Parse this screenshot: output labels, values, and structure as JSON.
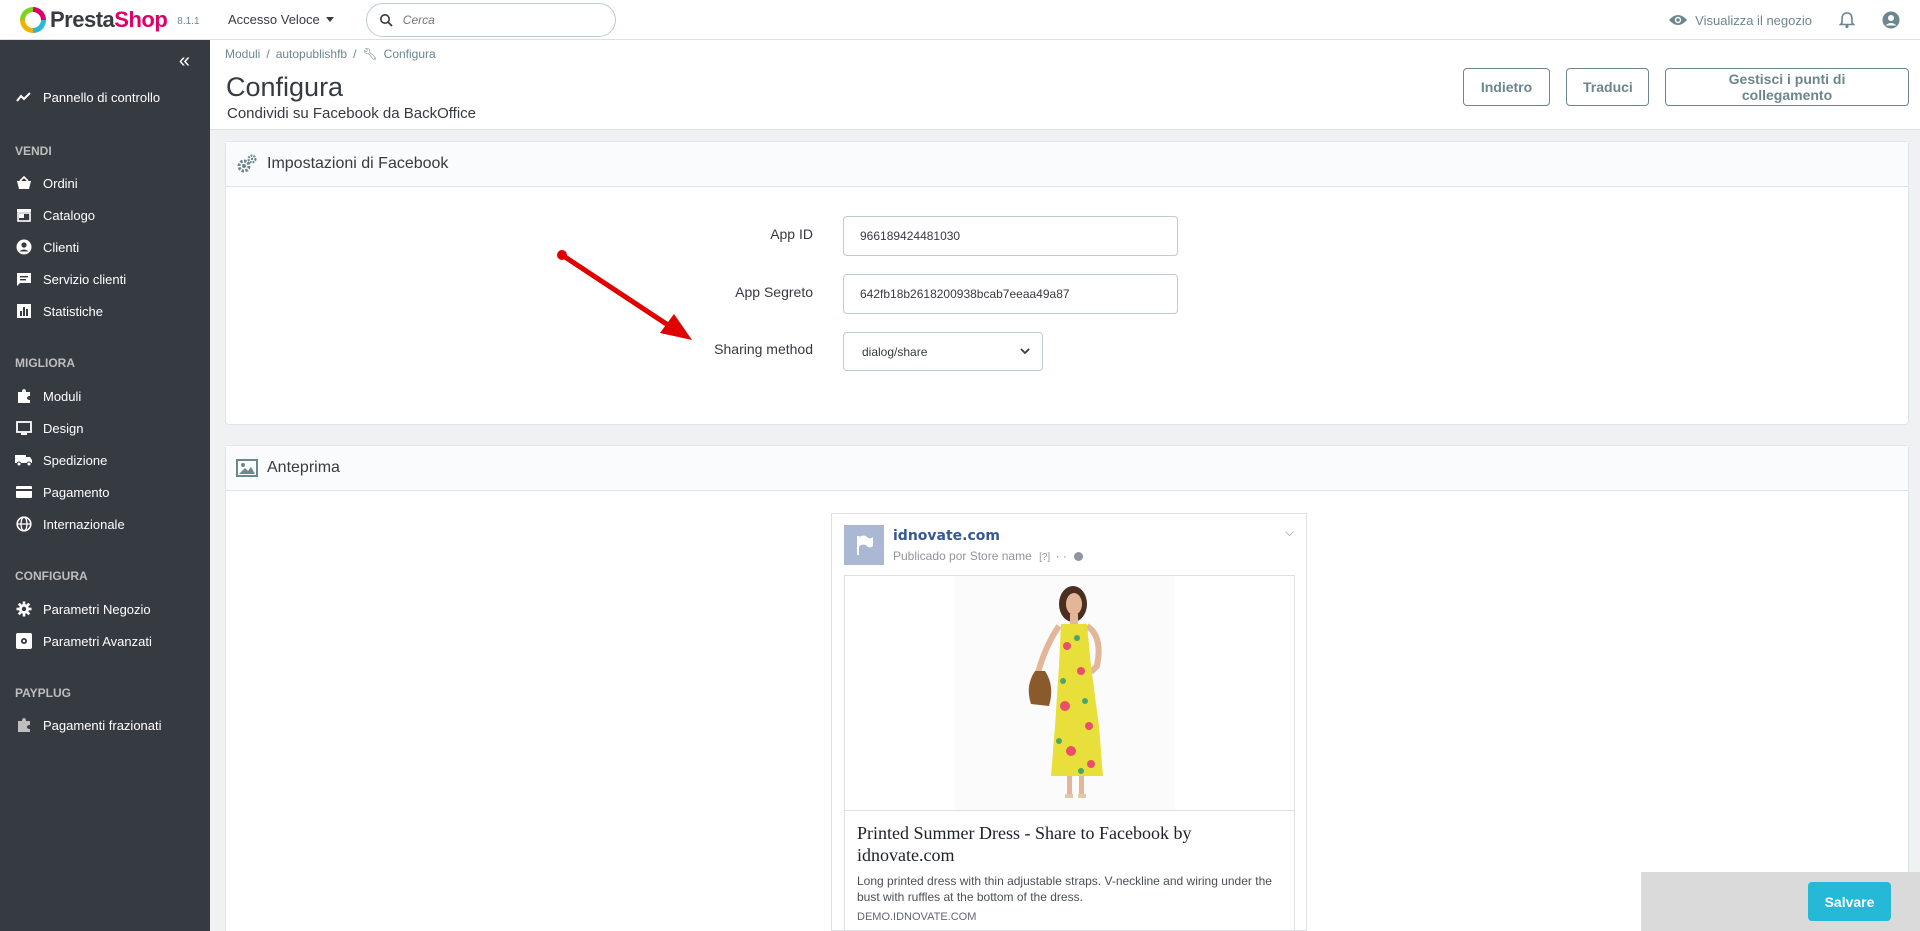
{
  "header": {
    "logo_presta": "Presta",
    "logo_shop": "Shop",
    "version": "8.1.1",
    "quick_access": "Accesso Veloce",
    "search_placeholder": "Cerca",
    "view_shop": "Visualizza il negozio"
  },
  "sidebar": {
    "dashboard": "Pannello di controllo",
    "section_sell": "VENDI",
    "orders": "Ordini",
    "catalog": "Catalogo",
    "customers": "Clienti",
    "customer_service": "Servizio clienti",
    "stats": "Statistiche",
    "section_improve": "MIGLIORA",
    "modules": "Moduli",
    "design": "Design",
    "shipping": "Spedizione",
    "payment": "Pagamento",
    "international": "Internazionale",
    "section_configure": "CONFIGURA",
    "shop_params": "Parametri Negozio",
    "advanced_params": "Parametri Avanzati",
    "section_payplug": "PAYPLUG",
    "split_payments": "Pagamenti frazionati"
  },
  "page": {
    "breadcrumb": [
      "Moduli",
      "autopublishfb",
      "Configura"
    ],
    "title": "Configura",
    "subtitle": "Condividi su Facebook da BackOffice",
    "btn_back": "Indietro",
    "btn_translate": "Traduci",
    "btn_hooks": "Gestisci i punti di collegamento"
  },
  "settings": {
    "heading": "Impostazioni di Facebook",
    "app_id_label": "App ID",
    "app_id_value": "966189424481030",
    "app_secret_label": "App Segreto",
    "app_secret_value": "642fb18b2618200938bcab7eeaa49a87",
    "sharing_label": "Sharing method",
    "sharing_value": "dialog/share"
  },
  "preview": {
    "heading": "Anteprima",
    "site": "idnovate.com",
    "published_by": "Publicado por Store name",
    "help": "[?]",
    "title": "Printed Summer Dress - Share to Facebook by idnovate.com",
    "description": "Long printed dress with thin adjustable straps. V-neckline and wiring under the bust with ruffles at the bottom of the dress.",
    "domain": "DEMO.IDNOVATE.COM"
  },
  "footer": {
    "save": "Salvare"
  },
  "colors": {
    "sidebar_bg": "#363a41",
    "brand_pink": "#df0067",
    "accent_blue": "#25b9d7",
    "annotation_arrow": "#e00000"
  }
}
